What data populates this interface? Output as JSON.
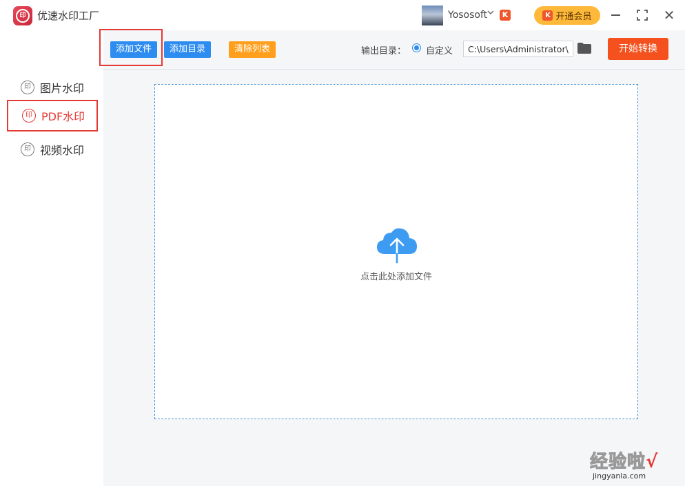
{
  "app": {
    "title": "优速水印工厂",
    "logo_text": "印"
  },
  "user": {
    "name": "Yososoft",
    "badge": "K"
  },
  "vip": {
    "label": "开通会员",
    "icon_text": "K"
  },
  "window_controls": {
    "close_glyph": "✕"
  },
  "sidebar": {
    "items": [
      {
        "label": "图片水印",
        "icon": "seal-icon",
        "icon_text": "印"
      },
      {
        "label": "PDF水印",
        "icon": "seal-icon",
        "icon_text": "印",
        "active": true
      },
      {
        "label": "视频水印",
        "icon": "seal-icon",
        "icon_text": "印"
      }
    ]
  },
  "toolbar": {
    "add_file": "添加文件",
    "add_dir": "添加目录",
    "clear_list": "清除列表",
    "output_label": "输出目录：",
    "radio_label": "自定义",
    "path_value": "C:\\Users\\Administrator\\",
    "start": "开始转换"
  },
  "dropzone": {
    "label": "点击此处添加文件"
  },
  "watermark": {
    "text": "经验啦",
    "check": "√",
    "url": "jingyanla.com"
  },
  "colors": {
    "primary_blue": "#2d8cf0",
    "orange": "#ff9f1c",
    "start_red": "#f4511e",
    "highlight_red": "#e53935",
    "vip_gold": "#ffb93a"
  }
}
